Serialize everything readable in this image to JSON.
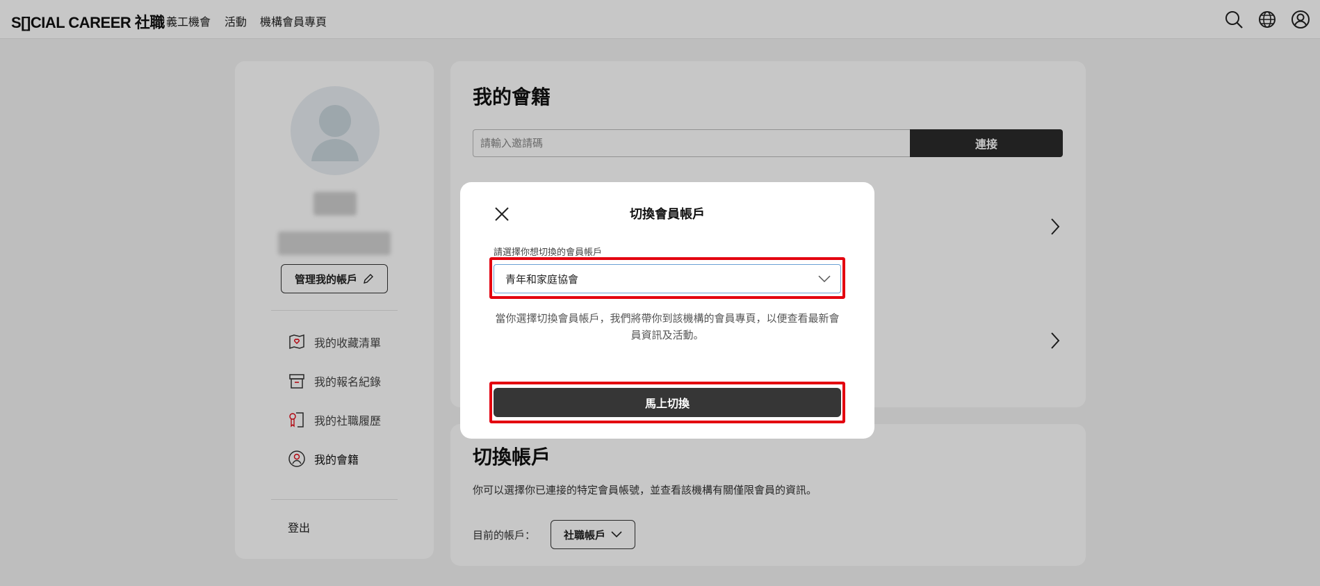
{
  "header": {
    "logo": "S[]CIAL CAREER 社職",
    "nav": [
      "義工機會",
      "活動",
      "機構會員專頁"
    ],
    "icons": [
      "search-icon",
      "globe-icon",
      "user-icon"
    ]
  },
  "sidebar": {
    "manage_account": "管理我的帳戶",
    "items": [
      {
        "label": "我的收藏清單",
        "icon": "bookmark-heart-icon"
      },
      {
        "label": "我的報名紀錄",
        "icon": "archive-box-icon"
      },
      {
        "label": "我的社職履歷",
        "icon": "resume-badge-icon"
      },
      {
        "label": "我的會籍",
        "icon": "membership-user-icon"
      }
    ],
    "logout": "登出"
  },
  "membership": {
    "title": "我的會籍",
    "invite_placeholder": "請輸入邀請碼",
    "connect_label": "連接"
  },
  "switch_section": {
    "title": "切換帳戶",
    "description": "你可以選擇你已連接的特定會員帳號，並查看該機構有關僅限會員的資訊。",
    "current_label": "目前的帳戶：",
    "current_value": "社職帳戶"
  },
  "modal": {
    "title": "切換會員帳戶",
    "field_label": "請選擇你想切換的會員帳戶",
    "selected_option": "青年和家庭協會",
    "note": "當你選擇切換會員帳戶，我們將帶你到該機構的會員專頁，以便查看最新會員資訊及活動。",
    "button_label": "馬上切換"
  },
  "colors": {
    "highlight": "#e3000f",
    "primary_button": "#2b2b2b",
    "select_border": "#6aa0d4"
  }
}
